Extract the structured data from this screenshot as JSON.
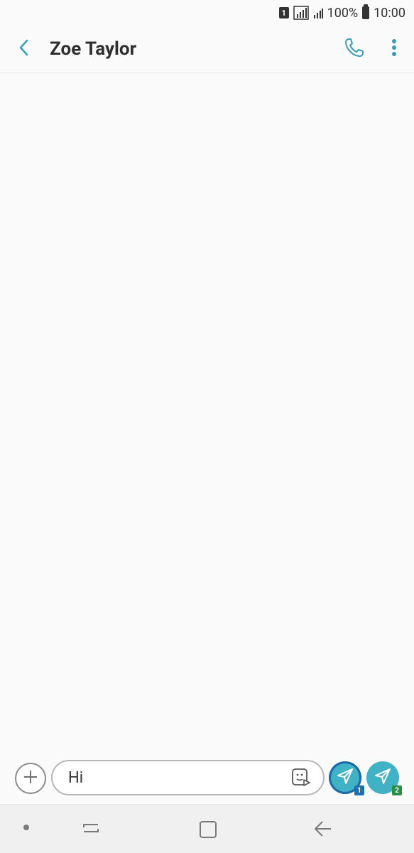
{
  "status_bar": {
    "sim_label": "1",
    "battery_percent": "100%",
    "time": "10:00",
    "icons": [
      "sim-1-icon",
      "signal-icon",
      "signal-weak-icon",
      "battery-icon"
    ]
  },
  "header": {
    "title": "Zoe Taylor",
    "icons": [
      "back-arrow-icon",
      "phone-icon",
      "more-vert-icon"
    ]
  },
  "composer": {
    "message_value": "Hi",
    "icons": [
      "plus-icon",
      "sticker-icon",
      "send-icon"
    ],
    "send_sim1_label": "1",
    "send_sim2_label": "2"
  },
  "nav_bar": {
    "icons": [
      "dot-icon",
      "recent-apps-icon",
      "home-icon",
      "back-icon"
    ]
  },
  "colors": {
    "accent": "#41b1c6",
    "sim1": "#1b70b3",
    "sim2": "#2a8f46",
    "background": "#fafafa"
  }
}
